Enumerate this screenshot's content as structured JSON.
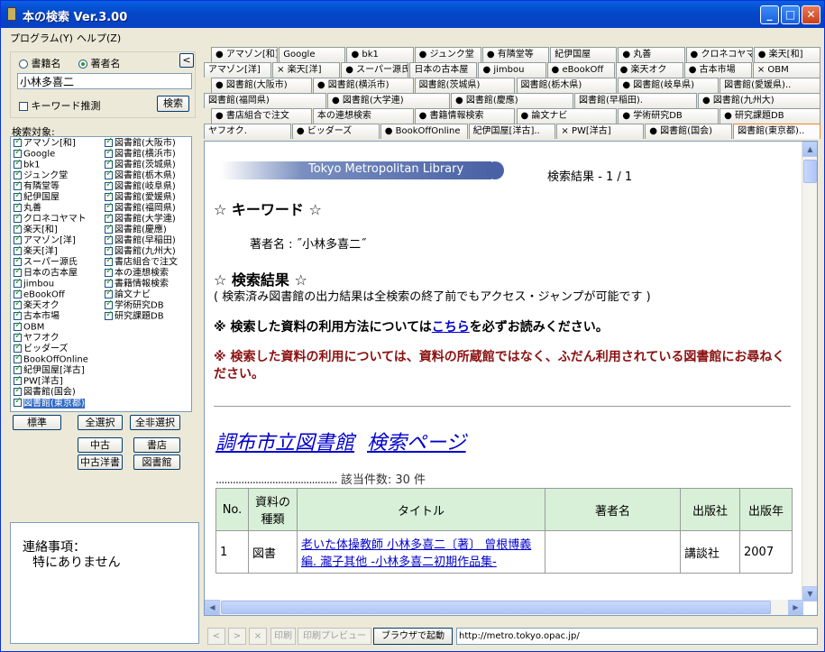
{
  "window": {
    "title": "本の検索 Ver.3.00",
    "buttons": {
      "minimize": "_",
      "maximize": "□",
      "close": "✕"
    }
  },
  "menu": {
    "items": [
      "プログラム(Y)",
      "ヘルプ(Z)"
    ]
  },
  "search": {
    "radio_title": "書籍名",
    "radio_author": "著者名",
    "author_selected": true,
    "input_value": "小林多喜二",
    "keyword_guess": "キーワード推測",
    "search_button": "検索",
    "collapse_button": "<"
  },
  "sources": {
    "label": "検索対象:",
    "col1": [
      "アマゾン[和]",
      "Google",
      "bk1",
      "ジュンク堂",
      "有隣堂等",
      "紀伊国屋",
      "丸善",
      "クロネコヤマト",
      "楽天[和]",
      "アマゾン[洋]",
      "楽天[洋]",
      "スーパー源氏",
      "日本の古本屋",
      "jimbou",
      "eBookOff",
      "楽天オク",
      "古本市場",
      "OBM",
      "ヤフオク",
      "ビッダーズ",
      "BookOffOnline",
      "紀伊国屋[洋古]",
      "PW[洋古]",
      "図書館(国会)",
      "図書館(東京都)"
    ],
    "col2": [
      "図書館(大阪市)",
      "図書館(横浜市)",
      "図書館(茨城県)",
      "図書館(栃木県)",
      "図書館(岐阜県)",
      "図書館(愛媛県)",
      "図書館(福岡県)",
      "図書館(大学連)",
      "図書館(慶應)",
      "図書館(早稲田)",
      "図書館(九州大)",
      "書店組合で注文",
      "本の連想検索",
      "書籍情報検索",
      "論文ナビ",
      "学術研究DB",
      "研究課題DB"
    ]
  },
  "buttons": {
    "standard": "標準",
    "select_all": "全選択",
    "deselect_all": "全非選択",
    "used": "中古",
    "bookstore": "書店",
    "used_foreign": "中古洋書",
    "library": "図書館"
  },
  "notes": {
    "title": "連絡事項：",
    "body": "特にありません"
  },
  "tabs": {
    "row1": [
      "● アマゾン[和]",
      "Google",
      "● bk1",
      "● ジュンク堂",
      "● 有隣堂等",
      "紀伊国屋",
      "● 丸善",
      "● クロネコヤマト",
      "● 楽天[和]"
    ],
    "row2": [
      "アマゾン[洋]",
      "× 楽天[洋]",
      "● スーパー源氏",
      "日本の古本屋",
      "● jimbou",
      "● eBookOff",
      "● 楽天オク",
      "● 古本市場",
      "× OBM"
    ],
    "row3": [
      "● 図書館(大阪市)",
      "● 図書館(横浜市)",
      "図書館(茨城県)",
      "図書館(栃木県)",
      "● 図書館(岐阜県)",
      "図書館(愛媛県).."
    ],
    "row4": [
      "図書館(福岡県)",
      "● 図書館(大学連)",
      "● 図書館(慶應)",
      "図書館(早稲田).",
      "● 図書館(九州大)"
    ],
    "row5": [
      "● 書店組合で注文",
      "本の連想検索",
      "● 書籍情報検索",
      "● 論文ナビ",
      "● 学術研究DB",
      "● 研究課題DB"
    ],
    "row6": [
      "ヤフオク.",
      "● ビッダーズ",
      "● BookOffOnline",
      "紀伊国屋[洋古]..",
      "× PW[洋古]",
      "● 図書館(国会)",
      "図書館(東京都).."
    ]
  },
  "page": {
    "banner": "Tokyo Metropolitan Library",
    "result_count": "検索結果 - 1 / 1",
    "keyword_heading": "☆ キーワード ☆",
    "keyword_value": "著者名 : ˝小林多喜二˝",
    "results_heading": "☆ 検索結果 ☆",
    "results_note": "( 検索済み図書館の出力結果は全検索の終了前でもアクセス・ジャンプが可能です )",
    "usage_prefix": "※ 検索した資料の利用方法については",
    "usage_link": "こちら",
    "usage_suffix": "を必ずお読みください。",
    "warning": "※ 検索した資料の利用については、資料の所蔵館ではなく、ふだん利用されている図書館にお尋ねください。",
    "library_link": "調布市立図書館",
    "search_page_link": "検索ページ",
    "hits": "該当件数: 30 件",
    "table_headers": [
      "No.",
      "資料の種類",
      "タイトル",
      "著者名",
      "出版社",
      "出版年"
    ],
    "rows": [
      {
        "no": "1",
        "type": "図書",
        "title": "老いた体操教師 小林多喜二〔著〕 曾根博義編. 瀧子其他 -小林多喜二初期作品集-",
        "author": "",
        "publisher": "講談社",
        "year": "2007"
      }
    ]
  },
  "bottom": {
    "back": "<",
    "forward": ">",
    "stop": "×",
    "print": "印刷",
    "preview": "印刷プレビュー",
    "browser": "ブラウザで起動",
    "url": "http://metro.tokyo.opac.jp/"
  }
}
